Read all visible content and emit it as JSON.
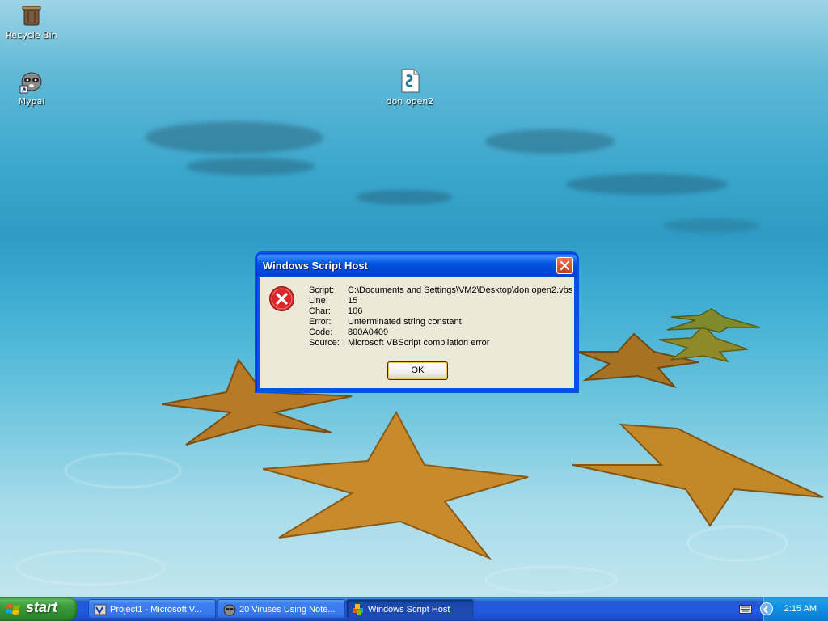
{
  "desktop": {
    "icons": [
      {
        "label": "Recycle Bin"
      },
      {
        "label": "Mypal"
      },
      {
        "label": "don open2"
      }
    ]
  },
  "dialog": {
    "title": "Windows Script Host",
    "rows": [
      {
        "key": "Script:",
        "value": "C:\\Documents and Settings\\VM2\\Desktop\\don open2.vbs"
      },
      {
        "key": "Line:",
        "value": "15"
      },
      {
        "key": "Char:",
        "value": "106"
      },
      {
        "key": "Error:",
        "value": "Unterminated string constant"
      },
      {
        "key": "Code:",
        "value": "800A0409"
      },
      {
        "key": "Source:",
        "value": "Microsoft VBScript compilation error"
      }
    ],
    "ok_label": "OK"
  },
  "taskbar": {
    "start_label": "start",
    "tasks": [
      {
        "label": "Project1 - Microsoft V..."
      },
      {
        "label": "20 Viruses Using Note..."
      },
      {
        "label": "Windows Script Host"
      }
    ],
    "clock": "2:15 AM"
  },
  "colors": {
    "titlebar": "#0257e0",
    "dialog_bg": "#ece9d8",
    "taskbar": "#225ae0",
    "start_green": "#3a9c3a",
    "tray": "#0f8ae0",
    "error_red": "#d8262a"
  }
}
